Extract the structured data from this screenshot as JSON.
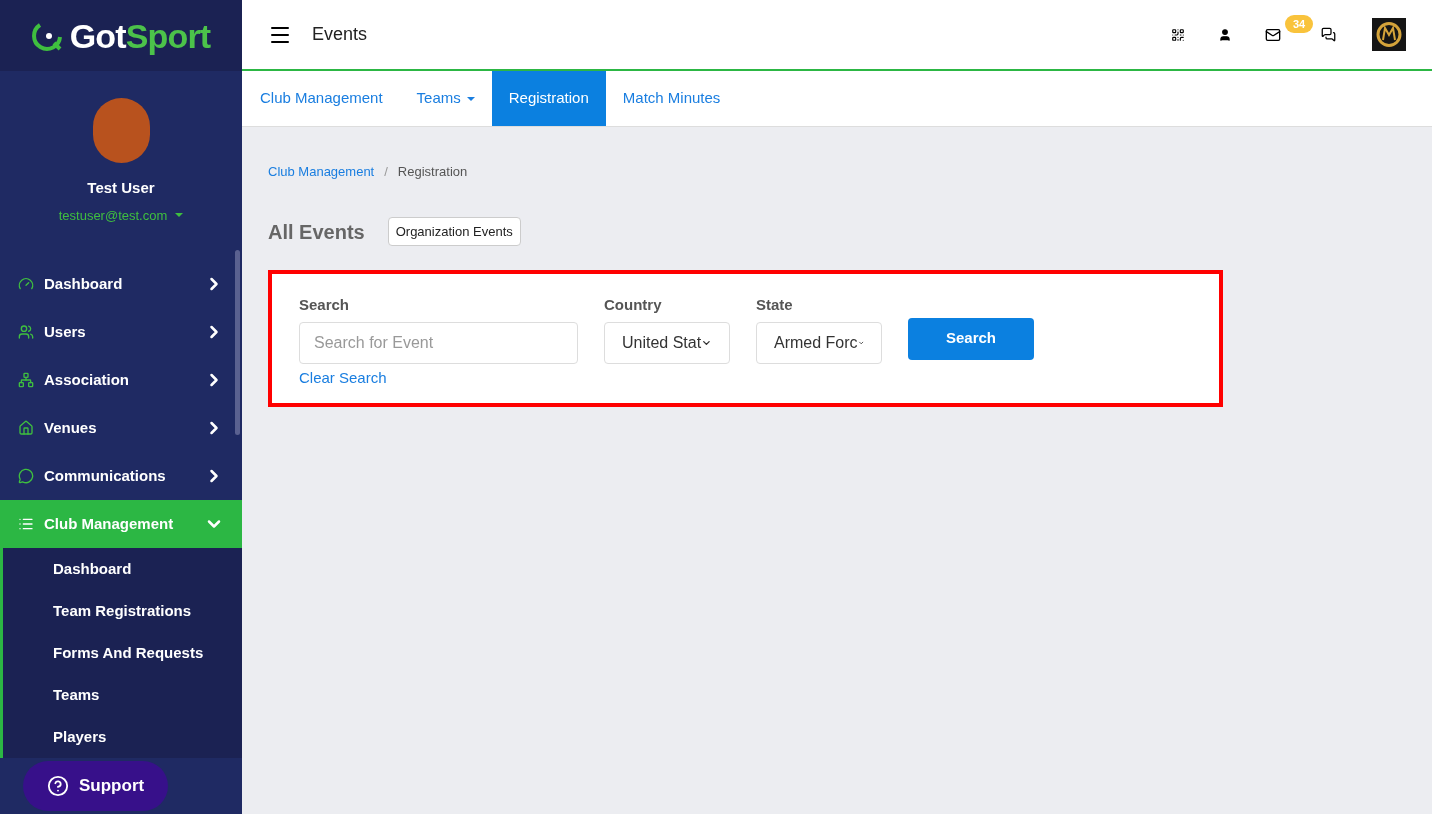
{
  "logo": {
    "part_1": "Got",
    "part_2": "Sport"
  },
  "user": {
    "name": "Test User",
    "email": "testuser@test.com"
  },
  "sidebar": {
    "items": [
      {
        "label": "Dashboard",
        "expanded": false,
        "selected": false
      },
      {
        "label": "Users",
        "expanded": false,
        "selected": false
      },
      {
        "label": "Association",
        "expanded": false,
        "selected": false
      },
      {
        "label": "Venues",
        "expanded": false,
        "selected": false
      },
      {
        "label": "Communications",
        "expanded": false,
        "selected": false
      },
      {
        "label": "Club Management",
        "expanded": true,
        "selected": true,
        "children": [
          {
            "label": "Dashboard"
          },
          {
            "label": "Team Registrations"
          },
          {
            "label": "Forms And Requests"
          },
          {
            "label": "Teams"
          },
          {
            "label": "Players"
          }
        ]
      }
    ]
  },
  "support_button": "Support",
  "header": {
    "title": "Events",
    "mail_badge": "34"
  },
  "tabs": [
    {
      "label": "Club Management",
      "selected": false,
      "dropdown": false
    },
    {
      "label": "Teams",
      "selected": false,
      "dropdown": true
    },
    {
      "label": "Registration",
      "selected": true,
      "dropdown": false
    },
    {
      "label": "Match Minutes",
      "selected": false,
      "dropdown": false
    }
  ],
  "breadcrumb": {
    "separator": "/",
    "items": [
      {
        "label": "Club Management",
        "link": true
      },
      {
        "label": "Registration",
        "link": false
      }
    ]
  },
  "page_title": "All Events",
  "org_events_button": "Organization Events",
  "search_panel": {
    "search": {
      "label": "Search",
      "placeholder": "Search for Event"
    },
    "clear_link": "Clear Search",
    "country": {
      "label": "Country",
      "value": "United Stat"
    },
    "state": {
      "label": "State",
      "value": "Armed Forc"
    },
    "button": "Search"
  }
}
